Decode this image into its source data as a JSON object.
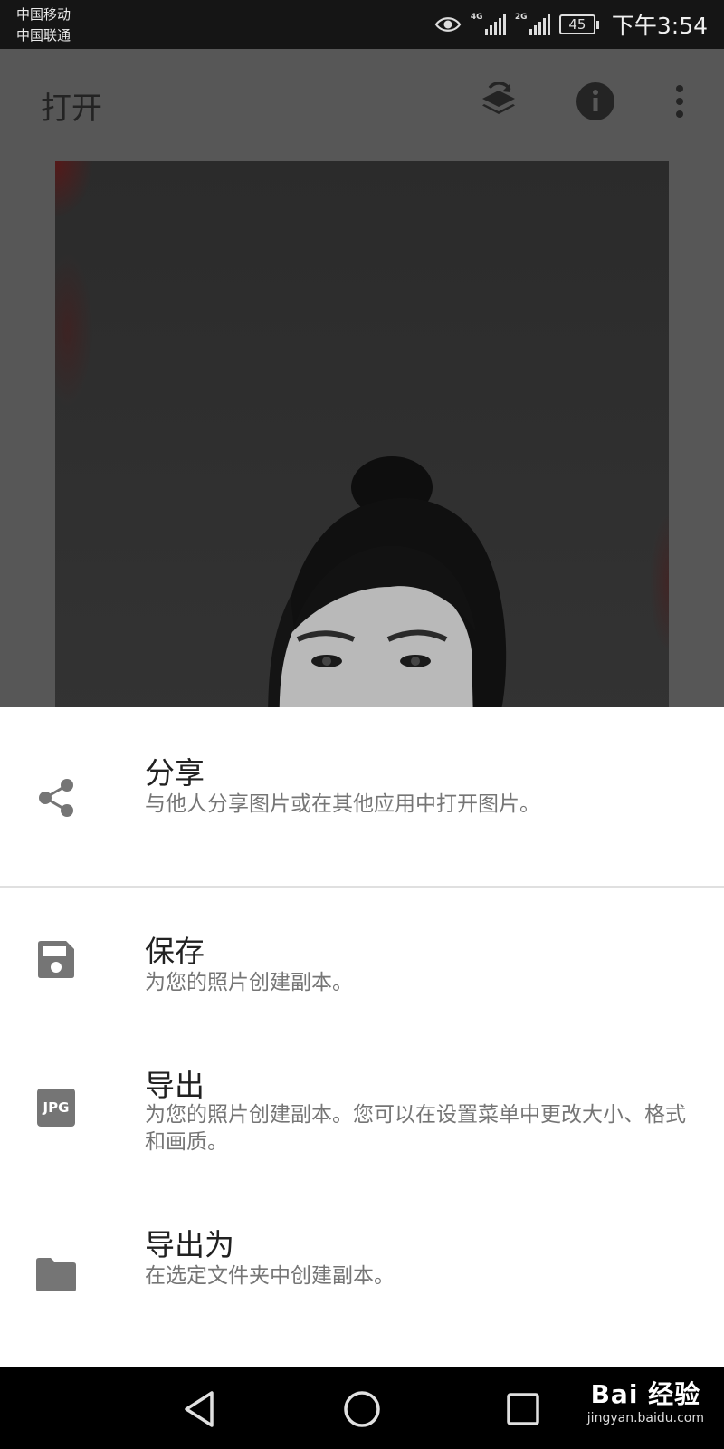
{
  "status_bar": {
    "carrier_1": "中国移动",
    "carrier_2": "中国联通",
    "signal_1_type": "4G",
    "signal_2_type": "2G",
    "battery": "45",
    "time": "下午3:54"
  },
  "app_bar": {
    "title": "打开",
    "icons": [
      "layers-refresh-icon",
      "info-icon",
      "more-vert-icon"
    ]
  },
  "sheet": {
    "items": [
      {
        "icon": "share-icon",
        "title": "分享",
        "description": "与他人分享图片或在其他应用中打开图片。"
      },
      {
        "icon": "save-icon",
        "title": "保存",
        "description": "为您的照片创建副本。"
      },
      {
        "icon": "jpg-icon",
        "icon_text": "JPG",
        "title": "导出",
        "description": "为您的照片创建副本。您可以在设置菜单中更改大小、格式和画质。"
      },
      {
        "icon": "folder-icon",
        "title": "导出为",
        "description": "在选定文件夹中创建副本。"
      }
    ]
  },
  "nav_bar": {
    "buttons": [
      "back-icon",
      "home-icon",
      "recents-icon"
    ],
    "watermark_brand": "Bai 经验",
    "watermark_site": "jingyan.baidu.com"
  },
  "colors": {
    "scrim": "#575757",
    "sheet_bg": "#ffffff",
    "icon_gray": "#757575",
    "title_text": "#212121",
    "desc_text": "#757575"
  }
}
